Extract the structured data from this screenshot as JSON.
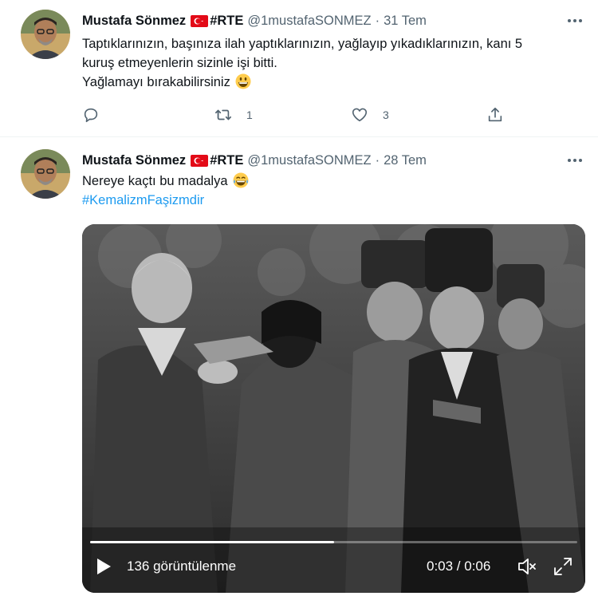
{
  "tweets": [
    {
      "author_name": "Mustafa Sönmez",
      "author_tag": "#RTE",
      "handle": "@1mustafaSONMEZ",
      "separator": "·",
      "date": "31 Tem",
      "text_line1": "Taptıklarınızın, başınıza ilah yaptıklarınızın, yağlayıp yıkadıklarınızın, kanı 5",
      "text_line2": "kuruş etmeyenlerin sizinle işi bitti.",
      "text_line3": "Yağlamayı bırakabilirsiniz",
      "emoji": "grinning-face-emoji",
      "reply_count": "",
      "retweet_count": "1",
      "like_count": "3"
    },
    {
      "author_name": "Mustafa Sönmez",
      "author_tag": "#RTE",
      "handle": "@1mustafaSONMEZ",
      "separator": "·",
      "date": "28 Tem",
      "text": "Nereye kaçtı bu madalya",
      "emoji": "face-with-tears-of-joy-emoji",
      "hashtag": "#KemalizmFaşizmdir",
      "video": {
        "views": "136 görüntülenme",
        "time": "0:03 / 0:06",
        "progress_fraction": 0.5
      }
    }
  ],
  "icons": {
    "more": "more-dots-icon",
    "reply": "reply-icon",
    "retweet": "retweet-icon",
    "like": "heart-icon",
    "share": "share-icon",
    "play": "play-icon",
    "mute": "volume-muted-icon",
    "fullscreen": "fullscreen-icon",
    "flag": "turkey-flag-icon"
  },
  "colors": {
    "link": "#1d9bf0",
    "secondary_text": "#536471",
    "primary_text": "#0f1419",
    "flag_red": "#e30a17"
  }
}
